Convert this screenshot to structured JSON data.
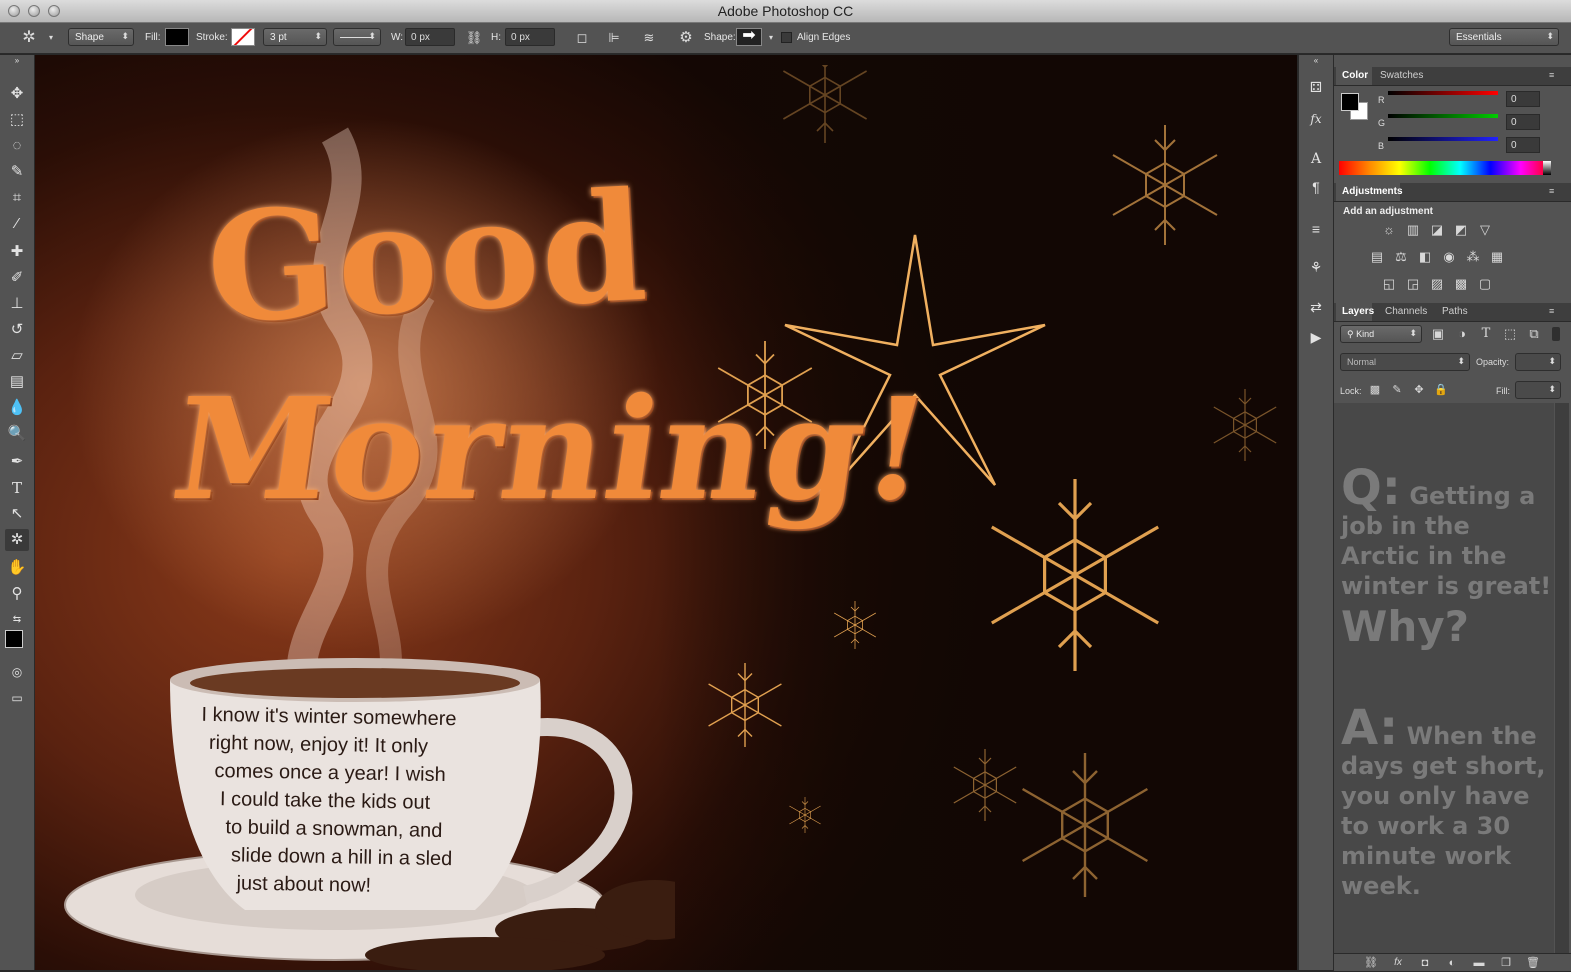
{
  "app": {
    "title": "Adobe Photoshop CC"
  },
  "options": {
    "mode_value": "Shape",
    "fill_label": "Fill:",
    "stroke_label": "Stroke:",
    "stroke_width": "3 pt",
    "w_label": "W:",
    "w_value": "0 px",
    "h_label": "H:",
    "h_value": "0 px",
    "shape_label": "Shape:",
    "align_edges_label": "Align Edges",
    "workspace_value": "Essentials"
  },
  "canvas": {
    "headline_line1": "Good",
    "headline_line2": "Morning!",
    "cup_text_lines": [
      "I know it's winter somewhere",
      "right now, enjoy it! It only",
      "comes once a year! I wish",
      "I could take the kids out",
      "to build a snowman, and",
      "slide down a hill in a sled",
      "just about now!"
    ]
  },
  "color_panel": {
    "tabs": [
      "Color",
      "Swatches"
    ],
    "channels": [
      {
        "label": "R",
        "value": "0"
      },
      {
        "label": "G",
        "value": "0"
      },
      {
        "label": "B",
        "value": "0"
      }
    ]
  },
  "adjustments_panel": {
    "tab": "Adjustments",
    "heading": "Add an adjustment"
  },
  "layers_panel": {
    "tabs": [
      "Layers",
      "Channels",
      "Paths"
    ],
    "kind_label": "Kind",
    "blend_mode": "Normal",
    "opacity_label": "Opacity:",
    "lock_label": "Lock:",
    "fill_label": "Fill:"
  },
  "joke": {
    "q_prefix": "Q:",
    "q_text_first": "Getting a",
    "q_lines": [
      "job in the",
      "Arctic in the",
      "winter is great!"
    ],
    "why": "Why?",
    "a_prefix": "A:",
    "a_text_first": "When the",
    "a_lines": [
      "days get short,",
      "you only have",
      "to work a 30",
      "minute work",
      "week."
    ]
  },
  "colors": {
    "canvas_bg": "#5a2210",
    "headline": "#f08a3a",
    "panel": "#535353"
  }
}
